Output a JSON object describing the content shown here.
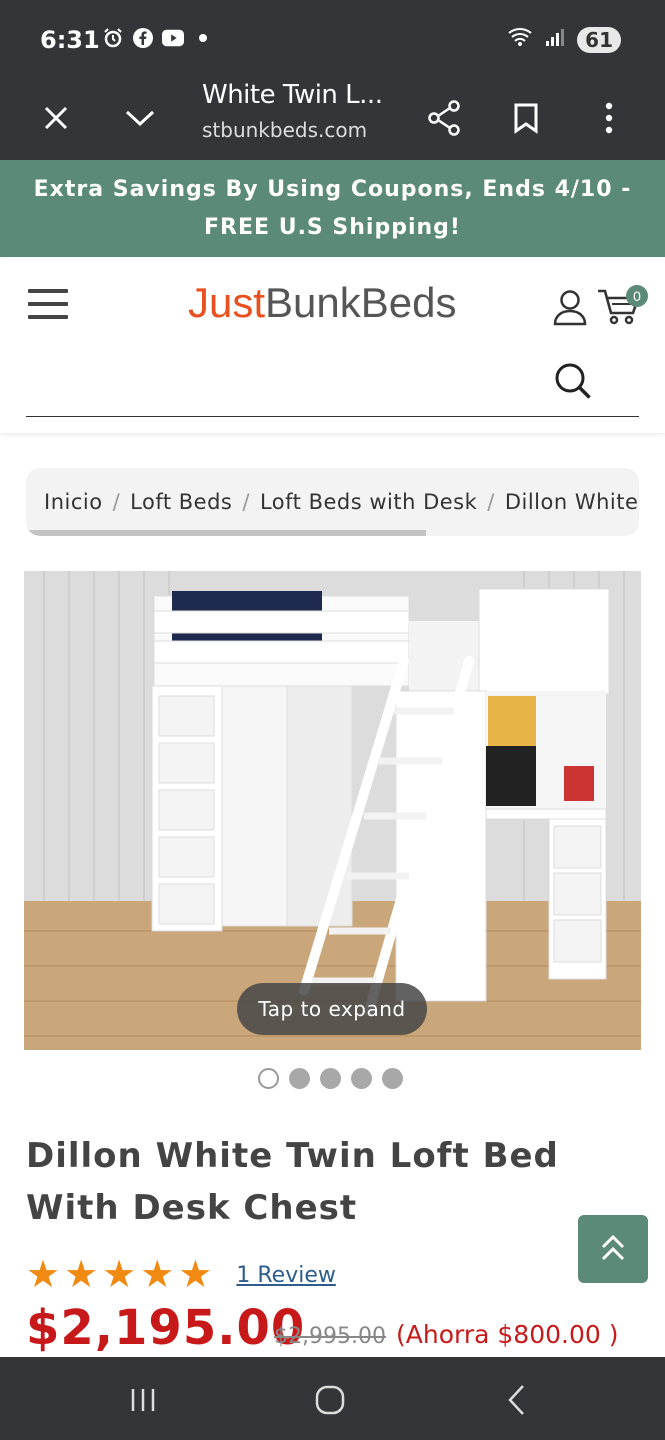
{
  "status": {
    "time": "6:31",
    "battery": "61",
    "wifi_label": "5"
  },
  "browser": {
    "title": "White Twin L...",
    "url": "stbunkbeds.com"
  },
  "promo": {
    "line1": "Extra Savings By Using Coupons, Ends 4/10 -",
    "line2": "FREE U.S Shipping!"
  },
  "header": {
    "logo_just": "Just",
    "logo_rest": "BunkBeds",
    "cart_count": "0",
    "search_placeholder": ""
  },
  "breadcrumb": [
    "Inicio",
    "Loft Beds",
    "Loft Beds with Desk",
    "Dillon White Twin Loft Bed With Desk Chest"
  ],
  "gallery": {
    "expand_label": "Tap to expand",
    "image_count": 5,
    "active_index": 0
  },
  "product": {
    "title": "Dillon White Twin Loft Bed With Desk Chest",
    "rating": 5,
    "reviews": "1 Review",
    "price": "$2,195.00",
    "old_price": "$2,995.00",
    "save": "(Ahorra $800.00 )"
  },
  "colors": {
    "accent": "#5b8a78",
    "price": "#c8191a",
    "star": "#f08a13",
    "logo_orange": "#e8501f"
  }
}
